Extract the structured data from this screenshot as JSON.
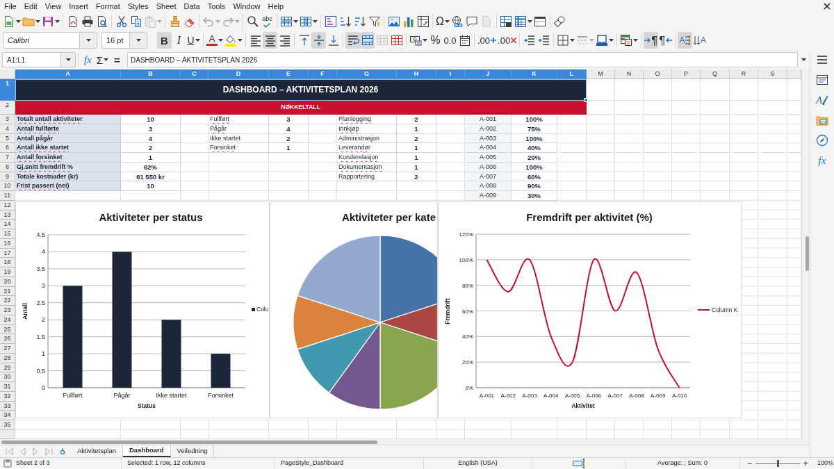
{
  "menu": [
    "File",
    "Edit",
    "View",
    "Insert",
    "Format",
    "Styles",
    "Sheet",
    "Data",
    "Tools",
    "Window",
    "Help"
  ],
  "standard_toolbar": [
    [
      {
        "kind": "new",
        "disabled": false
      },
      {
        "kind": "open",
        "disabled": false
      },
      {
        "kind": "save",
        "disabled": false
      }
    ],
    [
      {
        "kind": "export_pdf",
        "disabled": false
      },
      {
        "kind": "print",
        "disabled": false
      },
      {
        "kind": "print_preview",
        "disabled": false
      }
    ],
    [
      {
        "kind": "cut",
        "disabled": false
      },
      {
        "kind": "copy",
        "disabled": false
      },
      {
        "kind": "paste",
        "disabled": true
      }
    ],
    [
      {
        "kind": "clone_format",
        "disabled": false
      },
      {
        "kind": "clear_format",
        "disabled": false
      }
    ],
    [
      {
        "kind": "undo",
        "disabled": true
      },
      {
        "kind": "redo",
        "disabled": true
      }
    ],
    [
      {
        "kind": "find_replace",
        "disabled": false
      },
      {
        "kind": "spelling",
        "glyph": "abc",
        "disabled": false
      }
    ],
    [
      {
        "kind": "insert_rows",
        "disabled": false
      },
      {
        "kind": "insert_columns",
        "disabled": false
      }
    ],
    [
      {
        "kind": "sort",
        "disabled": false
      },
      {
        "kind": "sort_ascending",
        "disabled": false
      },
      {
        "kind": "sort_descending",
        "disabled": false
      },
      {
        "kind": "autofilter",
        "disabled": false
      }
    ],
    [
      {
        "kind": "image",
        "disabled": false
      },
      {
        "kind": "chart",
        "disabled": false
      },
      {
        "kind": "pivot_table",
        "disabled": false
      }
    ],
    [
      {
        "kind": "special_character",
        "glyph": "Ω",
        "disabled": false
      },
      {
        "kind": "hyperlink",
        "disabled": false
      },
      {
        "kind": "comment",
        "disabled": false
      },
      {
        "kind": "header_footer",
        "disabled": true
      }
    ],
    [
      {
        "kind": "print_range",
        "disabled": false
      },
      {
        "kind": "freeze",
        "disabled": false
      },
      {
        "kind": "split_window",
        "disabled": false
      }
    ],
    [
      {
        "kind": "draw_functions",
        "disabled": false
      }
    ]
  ],
  "formatting_toolbar": {
    "font_name": "Calibri",
    "font_size": "16 pt",
    "groups": [
      [
        {
          "kind": "bold",
          "glyph": "B",
          "on": true,
          "disabled": false
        },
        {
          "kind": "italic",
          "glyph": "I",
          "on": false,
          "disabled": false
        },
        {
          "kind": "underline",
          "glyph": "U",
          "on": false,
          "disabled": false
        }
      ],
      [
        {
          "kind": "font_color",
          "glyph": "A",
          "on": false,
          "disabled": false
        },
        {
          "kind": "highlight",
          "on": false,
          "disabled": false
        }
      ],
      [
        {
          "kind": "align_left",
          "on": false,
          "disabled": false
        },
        {
          "kind": "align_center",
          "on": true,
          "disabled": false
        },
        {
          "kind": "align_right",
          "on": false,
          "disabled": false
        }
      ],
      [
        {
          "kind": "align_top",
          "on": false,
          "disabled": false
        },
        {
          "kind": "align_middle",
          "on": true,
          "disabled": false
        },
        {
          "kind": "align_bottom",
          "on": false,
          "disabled": false
        }
      ],
      [
        {
          "kind": "wrap_text",
          "on": true,
          "disabled": false
        },
        {
          "kind": "merge_center",
          "on": true,
          "disabled": false
        },
        {
          "kind": "merge_cells",
          "on": false,
          "disabled": true
        },
        {
          "kind": "unmerge_cells",
          "on": false,
          "disabled": false
        }
      ],
      [
        {
          "kind": "currency",
          "on": false,
          "disabled": false
        },
        {
          "kind": "percent",
          "glyph": "%",
          "on": false,
          "disabled": false
        },
        {
          "kind": "number",
          "glyph": "0.0",
          "on": false,
          "disabled": false
        },
        {
          "kind": "date",
          "on": false,
          "disabled": false
        }
      ],
      [
        {
          "kind": "add_decimal",
          "glyph": ".00",
          "on": false,
          "disabled": false
        },
        {
          "kind": "delete_decimal",
          "glyph": ".00",
          "on": false,
          "disabled": false
        }
      ],
      [
        {
          "kind": "indent",
          "on": false,
          "disabled": false
        },
        {
          "kind": "outdent",
          "on": false,
          "disabled": false
        }
      ],
      [
        {
          "kind": "borders",
          "on": false,
          "disabled": false
        },
        {
          "kind": "border_style",
          "on": false,
          "disabled": true
        },
        {
          "kind": "border_color",
          "on": false,
          "disabled": false
        }
      ],
      [
        {
          "kind": "conditional",
          "on": false,
          "disabled": false
        }
      ],
      [
        {
          "kind": "paragraph_ltr",
          "glyph": "¶",
          "on": true,
          "disabled": false
        },
        {
          "kind": "paragraph_rtl",
          "glyph": "¶",
          "on": false,
          "disabled": false
        }
      ],
      [
        {
          "kind": "text_ltr",
          "glyph": "A",
          "on": true,
          "disabled": false
        },
        {
          "kind": "text_vertical",
          "glyph": "A",
          "on": false,
          "disabled": false
        }
      ]
    ]
  },
  "formula_bar": {
    "name_box": "A1:L1",
    "function_wizard": "fx",
    "sum": "Σ",
    "formula": "=",
    "content": "DASHBOARD – AKTIVITETSPLAN 2026"
  },
  "sidebar": [
    {
      "kind": "properties"
    },
    {
      "kind": "styles",
      "glyph": "A"
    },
    {
      "kind": "gallery"
    },
    {
      "kind": "navigator"
    },
    {
      "kind": "functions",
      "glyph": "fx"
    }
  ],
  "sheet": {
    "columns": [
      {
        "label": "A",
        "selected": true
      },
      {
        "label": "B",
        "selected": true
      },
      {
        "label": "C",
        "selected": true
      },
      {
        "label": "D",
        "selected": true
      },
      {
        "label": "E",
        "selected": true
      },
      {
        "label": "F",
        "selected": true
      },
      {
        "label": "G",
        "selected": true
      },
      {
        "label": "H",
        "selected": true
      },
      {
        "label": "I",
        "selected": true
      },
      {
        "label": "J",
        "selected": true
      },
      {
        "label": "K",
        "selected": true
      },
      {
        "label": "L",
        "selected": true
      },
      {
        "label": "M",
        "selected": false
      },
      {
        "label": "N",
        "selected": false
      },
      {
        "label": "O",
        "selected": false
      },
      {
        "label": "P",
        "selected": false
      },
      {
        "label": "Q",
        "selected": false
      },
      {
        "label": "R",
        "selected": false
      },
      {
        "label": "S",
        "selected": false
      }
    ],
    "rows": [
      {
        "label": "1",
        "selected": true
      },
      {
        "label": "2",
        "selected": false
      },
      {
        "label": "3",
        "selected": false
      },
      {
        "label": "4",
        "selected": false
      },
      {
        "label": "5",
        "selected": false
      },
      {
        "label": "6",
        "selected": false
      },
      {
        "label": "7",
        "selected": false
      },
      {
        "label": "8",
        "selected": false
      },
      {
        "label": "9",
        "selected": false
      },
      {
        "label": "10",
        "selected": false
      },
      {
        "label": "11",
        "selected": false
      },
      {
        "label": "12",
        "selected": false
      },
      {
        "label": "13",
        "selected": false
      },
      {
        "label": "14",
        "selected": false
      },
      {
        "label": "15",
        "selected": false
      },
      {
        "label": "16",
        "selected": false
      },
      {
        "label": "17",
        "selected": false
      },
      {
        "label": "18",
        "selected": false
      },
      {
        "label": "19",
        "selected": false
      },
      {
        "label": "20",
        "selected": false
      },
      {
        "label": "21",
        "selected": false
      },
      {
        "label": "22",
        "selected": false
      },
      {
        "label": "23",
        "selected": false
      },
      {
        "label": "24",
        "selected": false
      },
      {
        "label": "25",
        "selected": false
      },
      {
        "label": "26",
        "selected": false
      },
      {
        "label": "27",
        "selected": false
      },
      {
        "label": "28",
        "selected": false
      },
      {
        "label": "29",
        "selected": false
      },
      {
        "label": "30",
        "selected": false
      },
      {
        "label": "31",
        "selected": false
      },
      {
        "label": "32",
        "selected": false
      },
      {
        "label": "33",
        "selected": false
      },
      {
        "label": "34",
        "selected": false
      },
      {
        "label": "35",
        "selected": false
      }
    ],
    "title": "DASHBOARD – AKTIVITETSPLAN 2026",
    "section_header": "NØKKELTALL",
    "key_figures": {
      "spell_marked": true,
      "items": [
        {
          "label": "Totalt antall aktiviteter",
          "value": "10"
        },
        {
          "label": "Antall fullførte",
          "value": "3"
        },
        {
          "label": "Antall pågår",
          "value": "4"
        },
        {
          "label": "Antall ikke startet",
          "value": "2"
        },
        {
          "label": "Antall forsinket",
          "value": "1"
        },
        {
          "label": "Gj.snitt fremdrift %",
          "value": "62%"
        },
        {
          "label": "Totale kostnader (kr)",
          "value": "61 550 kr"
        },
        {
          "label": "Frist passert (nei)",
          "value": "10"
        }
      ]
    },
    "status_counts": {
      "spell_marked": true,
      "items": [
        {
          "label": "Fullført",
          "value": "3"
        },
        {
          "label": "Pågår",
          "value": "4"
        },
        {
          "label": "Ikke startet",
          "value": "2"
        },
        {
          "label": "Forsinket",
          "value": "1"
        }
      ]
    },
    "category_counts": {
      "spell_marked": true,
      "items": [
        {
          "label": "Planlegging",
          "value": "2"
        },
        {
          "label": "Innkjøp",
          "value": "1"
        },
        {
          "label": "Administrasjon",
          "value": "2"
        },
        {
          "label": "Leverandør",
          "value": "1"
        },
        {
          "label": "Kunderelasjon",
          "value": "1"
        },
        {
          "label": "Dokumentasjon",
          "value": "1"
        },
        {
          "label": "Rapportering",
          "value": "2"
        }
      ]
    },
    "progress": {
      "items": [
        {
          "label": "A-001",
          "value": "100%"
        },
        {
          "label": "A-002",
          "value": "75%"
        },
        {
          "label": "A-003",
          "value": "100%"
        },
        {
          "label": "A-004",
          "value": "40%"
        },
        {
          "label": "A-005",
          "value": "20%"
        },
        {
          "label": "A-006",
          "value": "100%"
        },
        {
          "label": "A-007",
          "value": "60%"
        },
        {
          "label": "A-008",
          "value": "90%"
        },
        {
          "label": "A-009",
          "value": "30%"
        }
      ]
    },
    "charts": [
      {
        "chart_data": {
          "type": "bar",
          "title": "Aktiviteter per status",
          "xlabel": "Status",
          "ylabel": "Antall",
          "categories": [
            "Fullført",
            "Pågår",
            "Ikke startet",
            "Forsinket"
          ],
          "series": [
            {
              "name": "Colu",
              "color": "#1d2639",
              "values": [
                3,
                4,
                2,
                1
              ]
            }
          ],
          "ylim": [
            0,
            4.5
          ],
          "yticks": [
            0,
            0.5,
            1,
            1.5,
            2,
            2.5,
            3,
            3.5,
            4,
            4.5
          ],
          "grid": true
        }
      },
      {
        "chart_data": {
          "type": "pie",
          "title": "Aktiviteter per kate",
          "values": [
            20,
            10,
            20,
            10,
            10,
            10,
            20
          ]
        }
      },
      {
        "chart_data": {
          "type": "line",
          "title": "Fremdrift per aktivitet (%)",
          "xlabel": "Aktivitet",
          "ylabel": "Fremdrift",
          "categories": [
            "A-001",
            "A-002",
            "A-003",
            "A-004",
            "A-005",
            "A-006",
            "A-007",
            "A-008",
            "A-009",
            "A-010"
          ],
          "series": [
            {
              "name": "Column K",
              "color": "#c8102e",
              "values": [
                100,
                75,
                100,
                40,
                20,
                100,
                60,
                90,
                30,
                0
              ]
            }
          ],
          "ylim": [
            0,
            120
          ],
          "yticks": [
            {
              "value": 0,
              "label": "0%"
            },
            {
              "value": 20,
              "label": "20%"
            },
            {
              "value": 40,
              "label": "40%"
            },
            {
              "value": 60,
              "label": "60%"
            },
            {
              "value": 80,
              "label": "80%"
            },
            {
              "value": 100,
              "label": "100%"
            },
            {
              "value": 120,
              "label": "120%"
            }
          ],
          "grid": true
        }
      }
    ]
  },
  "sheet_tabs": {
    "navigation": [
      {
        "kind": "first",
        "disabled": true
      },
      {
        "kind": "previous",
        "disabled": true
      },
      {
        "kind": "next",
        "disabled": true
      },
      {
        "kind": "last",
        "disabled": true
      }
    ],
    "tabs": [
      {
        "label": "Aktivitetsplan",
        "selected": false
      },
      {
        "label": "Dashboard",
        "selected": true
      },
      {
        "label": "Veiledning",
        "selected": false
      }
    ]
  },
  "status_bar": {
    "sheet": "Sheet 2 of 3",
    "selection": "Selected: 1 row, 12 columns",
    "page_style": "PageStyle_Dashboard",
    "language": "English (USA)",
    "summary": "Average: ; Sum: 0",
    "zoom_out": "−",
    "zoom_slider": {
      "level": 0.5
    },
    "zoom_in": "+",
    "zoom": "100%"
  }
}
